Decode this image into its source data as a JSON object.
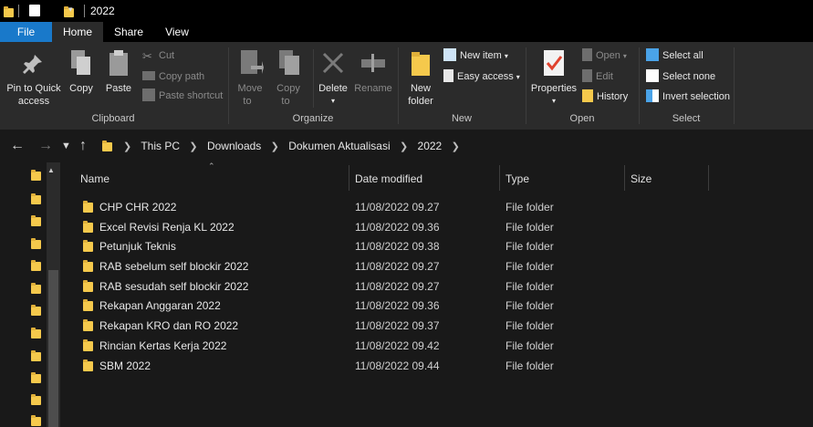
{
  "window": {
    "title": "2022"
  },
  "tabs": [
    {
      "label": "File"
    },
    {
      "label": "Home"
    },
    {
      "label": "Share"
    },
    {
      "label": "View"
    }
  ],
  "ribbon": {
    "clipboard": {
      "group": "Clipboard",
      "pin_line1": "Pin to Quick",
      "pin_line2": "access",
      "copy": "Copy",
      "paste": "Paste",
      "cut": "Cut",
      "copy_path": "Copy path",
      "paste_shortcut": "Paste shortcut"
    },
    "organize": {
      "group": "Organize",
      "move_line1": "Move",
      "move_line2": "to",
      "copy_line1": "Copy",
      "copy_line2": "to",
      "delete": "Delete",
      "rename": "Rename"
    },
    "new": {
      "group": "New",
      "folder_line1": "New",
      "folder_line2": "folder",
      "new_item": "New item",
      "easy_access": "Easy access"
    },
    "open": {
      "group": "Open",
      "properties": "Properties",
      "open": "Open",
      "edit": "Edit",
      "history": "History"
    },
    "select": {
      "group": "Select",
      "select_all": "Select all",
      "select_none": "Select none",
      "invert": "Invert selection"
    }
  },
  "breadcrumbs": [
    "This PC",
    "Downloads",
    "Dokumen Aktualisasi",
    "2022"
  ],
  "columns": {
    "name": "Name",
    "date": "Date modified",
    "type": "Type",
    "size": "Size"
  },
  "files": [
    {
      "name": "CHP CHR 2022",
      "date": "11/08/2022 09.27",
      "type": "File folder"
    },
    {
      "name": "Excel Revisi Renja KL 2022",
      "date": "11/08/2022 09.36",
      "type": "File folder"
    },
    {
      "name": "Petunjuk Teknis",
      "date": "11/08/2022 09.38",
      "type": "File folder"
    },
    {
      "name": "RAB sebelum self blockir 2022",
      "date": "11/08/2022 09.27",
      "type": "File folder"
    },
    {
      "name": "RAB sesudah self blockir 2022",
      "date": "11/08/2022 09.27",
      "type": "File folder"
    },
    {
      "name": "Rekapan Anggaran 2022",
      "date": "11/08/2022 09.36",
      "type": "File folder"
    },
    {
      "name": "Rekapan KRO dan RO 2022",
      "date": "11/08/2022 09.37",
      "type": "File folder"
    },
    {
      "name": "Rincian Kertas Kerja 2022",
      "date": "11/08/2022 09.42",
      "type": "File folder"
    },
    {
      "name": "SBM 2022",
      "date": "11/08/2022 09.44",
      "type": "File folder"
    }
  ],
  "colors": {
    "accent": "#1979ca",
    "folder": "#f5c94c",
    "ribbon": "#2b2b2b",
    "background": "#191919"
  }
}
